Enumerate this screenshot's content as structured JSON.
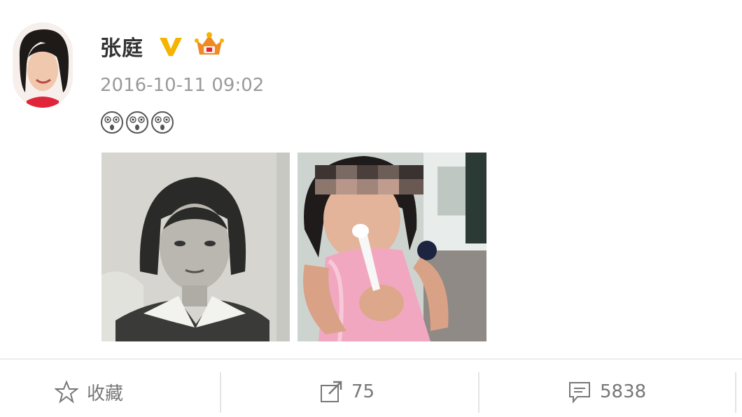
{
  "post": {
    "author": "张庭",
    "timestamp": "2016-10-11 09:02",
    "content_emojis": [
      "shocked-face-emoji",
      "shocked-face-emoji",
      "shocked-face-emoji"
    ],
    "photos": [
      {
        "description_icon": "photo-thumbnail"
      },
      {
        "description_icon": "photo-thumbnail"
      }
    ]
  },
  "badges": {
    "verified": "verified-v-icon",
    "member": "crown-member-icon"
  },
  "actions": {
    "favorite_label": "收藏",
    "share_count": "75",
    "comment_count": "5838"
  },
  "colors": {
    "verified": "#f4b400",
    "crown": "#f08a24",
    "text_muted": "#9a9a9a"
  }
}
